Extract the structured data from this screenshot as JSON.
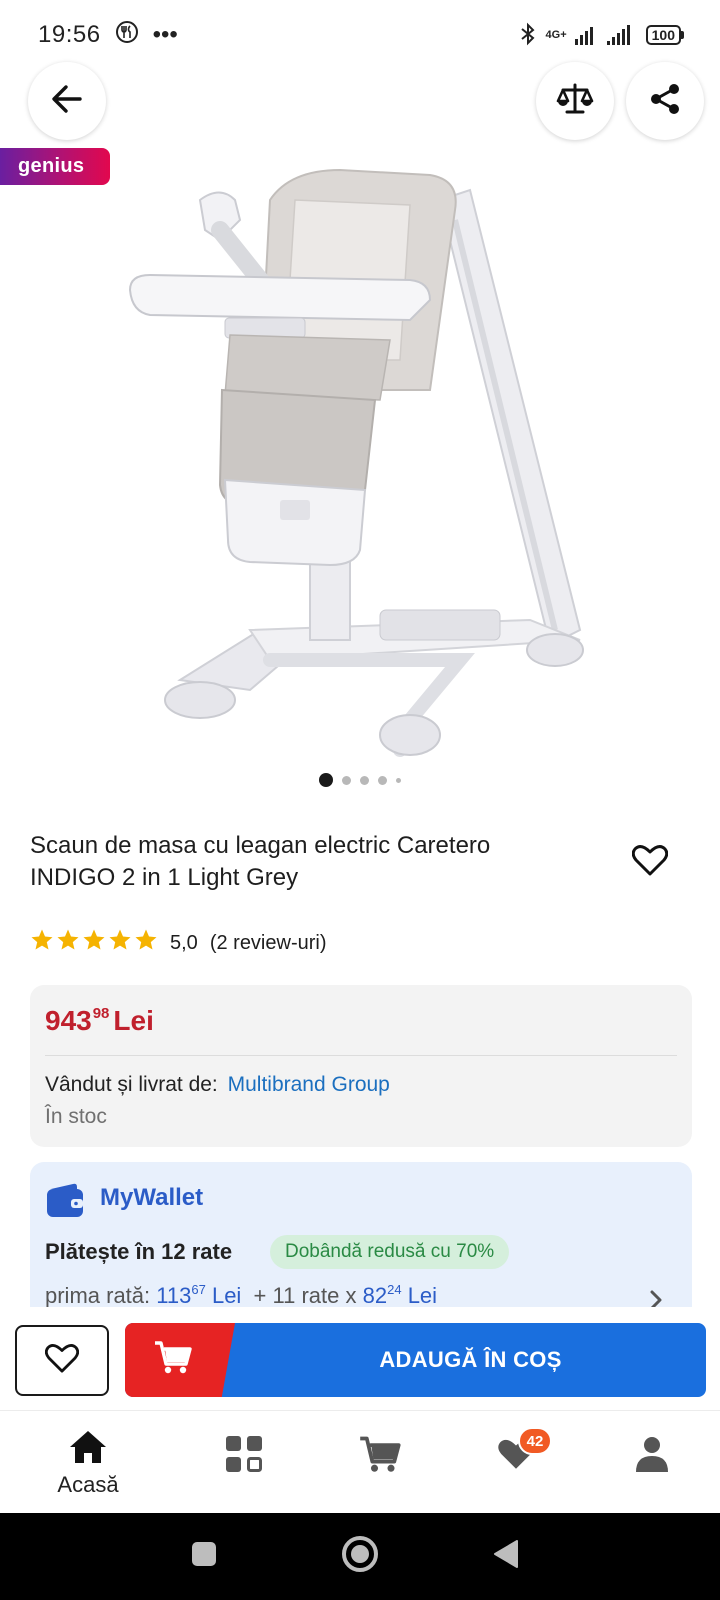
{
  "status_bar": {
    "time": "19:56",
    "more": "•••",
    "network": "4G+",
    "battery": "100"
  },
  "header": {
    "back_icon": "arrow-left-icon",
    "compare_icon": "scale-icon",
    "share_icon": "share-icon"
  },
  "badge": {
    "label": "genius"
  },
  "gallery": {
    "image_description": "white high chair with light grey seat",
    "image_count": 5,
    "active_index": 0
  },
  "product": {
    "title": "Scaun de masa cu leagan electric Caretero INDIGO 2 in 1 Light Grey",
    "rating_value": "5,0",
    "rating_count": "(2 review-uri)",
    "stars": 5
  },
  "price": {
    "integer": "943",
    "decimals": "98",
    "currency": "Lei",
    "seller_label": "Vândut și livrat de:",
    "seller_name": "Multibrand Group",
    "stock": "În stoc"
  },
  "wallet": {
    "title": "MyWallet",
    "rates_label": "Plătește în 12 rate",
    "interest_badge": "Dobândă redusă cu 70%",
    "first_rate_label": "prima rată:",
    "first_rate_int": "113",
    "first_rate_dec": "67",
    "first_rate_currency": "Lei",
    "rest_label": "+ 11 rate x",
    "rest_int": "82",
    "rest_dec": "24",
    "rest_currency": "Lei"
  },
  "actions": {
    "add_to_cart": "ADAUGĂ ÎN COȘ"
  },
  "bottom_nav": {
    "home_label": "Acasă",
    "favorites_count": "42"
  },
  "colors": {
    "price_red": "#c0202d",
    "link_blue": "#1b6fbf",
    "wallet_blue": "#2b5cc7",
    "cart_red": "#e62323",
    "cart_blue": "#1a6fde",
    "badge_orange": "#f15a24",
    "star_yellow": "#f5b301"
  }
}
